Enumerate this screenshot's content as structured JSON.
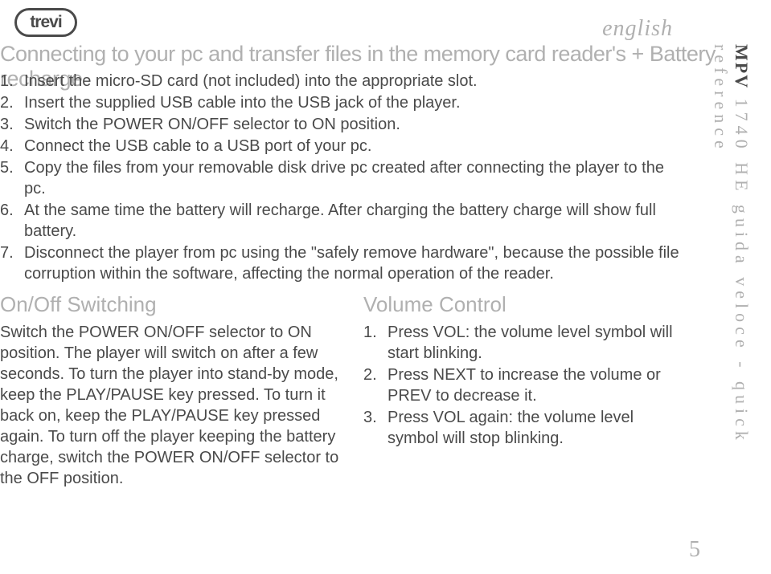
{
  "logo": "trevi",
  "english_label": "english",
  "title": "Connecting to your pc and transfer files in the memory card reader's + Battery recharge",
  "steps": [
    {
      "n": "1.",
      "t": "Insert the micro-SD card (not included) into the appropriate slot."
    },
    {
      "n": "2.",
      "t": "Insert the supplied USB cable into the USB jack of the player."
    },
    {
      "n": "3.",
      "t": "Switch the POWER ON/OFF selector to ON position."
    },
    {
      "n": "4.",
      "t": "Connect the USB cable to a USB port of your pc."
    },
    {
      "n": "5.",
      "t": "Copy the files from your removable disk drive pc created after connecting the player to the pc."
    },
    {
      "n": "6.",
      "t": "At the same time the battery will recharge. After charging the battery charge will show full battery."
    },
    {
      "n": "7.",
      "t": "Disconnect the player from pc using the \"safely remove hardware\", because the possible file corruption within the software, affecting the normal operation of the reader."
    }
  ],
  "onoff": {
    "title": "On/Off Switching",
    "body": "Switch the POWER ON/OFF selector to ON position. The player will switch on after a few seconds. To turn the player into stand-by mode, keep the PLAY/PAUSE key pressed. To turn it back on, keep the PLAY/PAUSE key pressed again.\nTo turn off the player keeping the battery charge, switch the POWER ON/OFF selector to the OFF position."
  },
  "volume": {
    "title": "Volume Control",
    "items": [
      {
        "n": "1.",
        "t": "Press VOL: the volume level symbol will start blinking."
      },
      {
        "n": "2.",
        "t": "Press NEXT to increase the volume or PREV to decrease it."
      },
      {
        "n": "3.",
        "t": "Press VOL again: the volume level symbol will stop blinking."
      }
    ]
  },
  "side": {
    "mpv": "MPV",
    "rest": " 1740 HE guida veloce - quick reference"
  },
  "page": "5"
}
